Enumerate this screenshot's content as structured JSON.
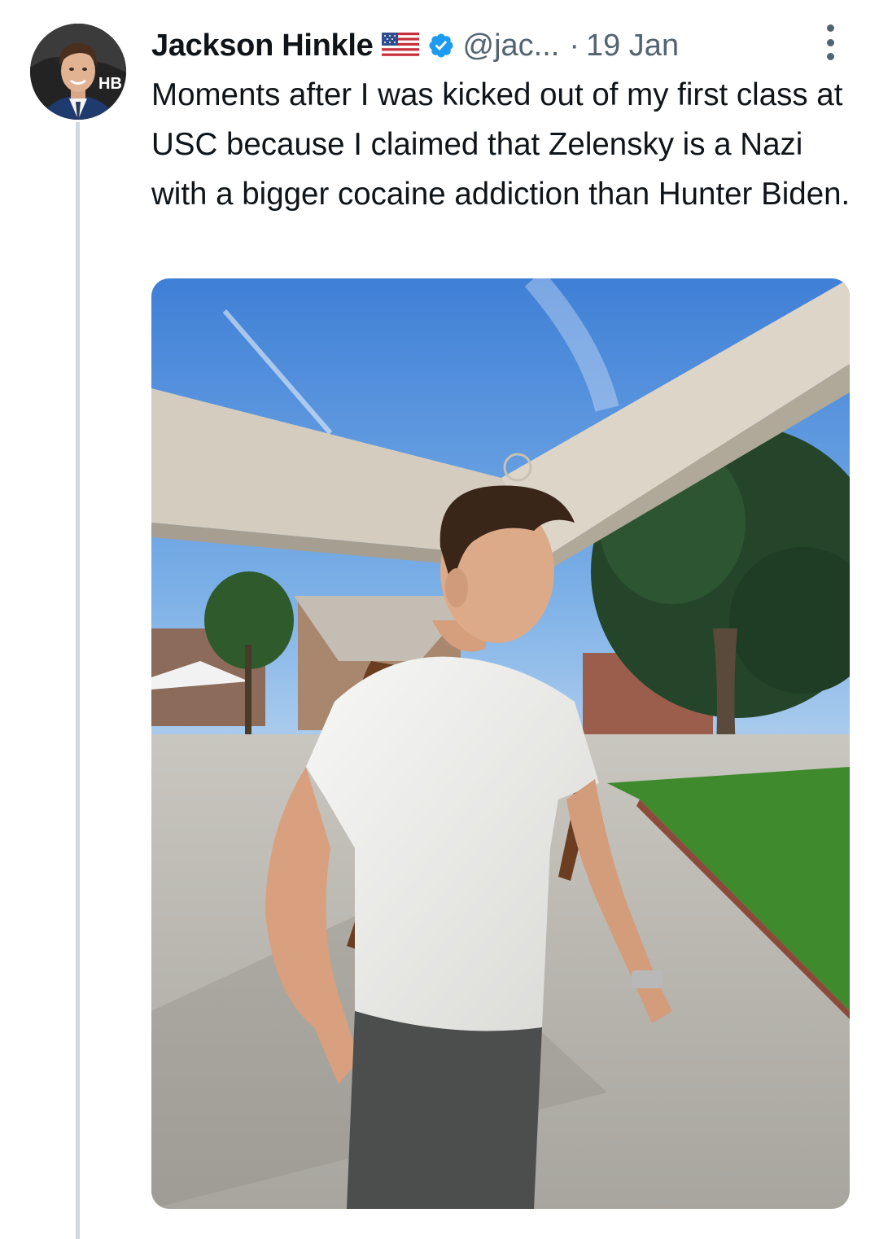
{
  "tweet": {
    "author_name": "Jackson Hinkle",
    "handle": "@jac...",
    "separator": "·",
    "date": "19 Jan",
    "avatar_text": "HB",
    "text": "Moments after I was kicked out of my first class at USC because I claimed that Zelensky is a Nazi with a bigger cocaine addiction than Hunter Biden."
  },
  "icons": {
    "flag": "us-flag-icon",
    "verified": "verified-badge-icon",
    "more": "more-options-icon"
  },
  "colors": {
    "verified_blue": "#1d9bf0",
    "secondary_text": "#536471",
    "primary_text": "#0f1419",
    "thread_line": "#cfd9de"
  }
}
